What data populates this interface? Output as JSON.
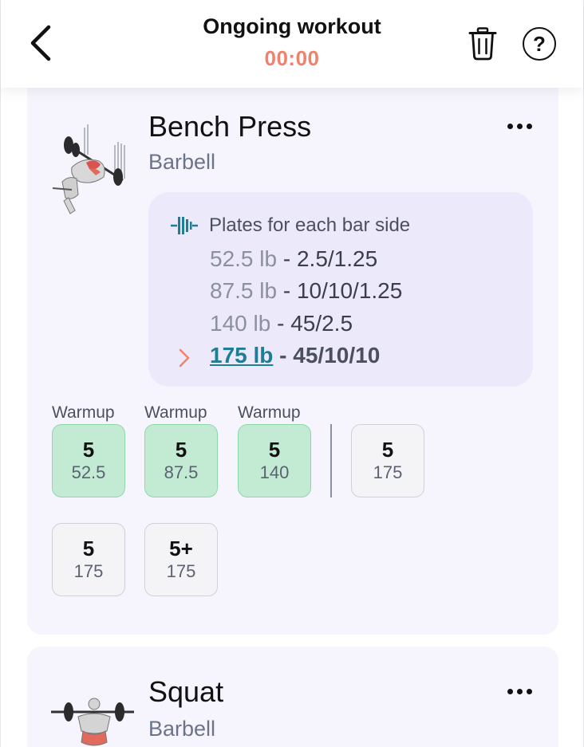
{
  "header": {
    "title": "Ongoing workout",
    "timer": "00:00",
    "icons": {
      "back": "chevron-left-icon",
      "trash": "trash-icon",
      "help": "help-icon"
    },
    "help_glyph": "?"
  },
  "exercises": [
    {
      "name": "Bench Press",
      "equipment": "Barbell",
      "plates": {
        "title": "Plates for each bar side",
        "rows": [
          {
            "weight": "52.5 lb",
            "separator": " - ",
            "plates": "2.5/1.25"
          },
          {
            "weight": "87.5 lb",
            "separator": " - ",
            "plates": "10/10/1.25"
          },
          {
            "weight": "140 lb",
            "separator": " - ",
            "plates": "45/2.5"
          },
          {
            "weight": "175 lb",
            "separator": " - ",
            "plates": "45/10/10"
          }
        ]
      },
      "warmup_label": "Warmup",
      "sets": [
        {
          "reps": "5",
          "weight": "52.5",
          "warmup": true,
          "completed": true
        },
        {
          "reps": "5",
          "weight": "87.5",
          "warmup": true,
          "completed": true
        },
        {
          "reps": "5",
          "weight": "140",
          "warmup": true,
          "completed": true
        },
        {
          "reps": "5",
          "weight": "175",
          "warmup": false,
          "completed": false
        },
        {
          "reps": "5",
          "weight": "175",
          "warmup": false,
          "completed": false
        },
        {
          "reps": "5+",
          "weight": "175",
          "warmup": false,
          "completed": false
        }
      ]
    },
    {
      "name": "Squat",
      "equipment": "Barbell"
    }
  ],
  "colors": {
    "accent_timer": "#f0826b",
    "card_bg": "#f6f5fd",
    "plates_bg": "#ece9fb",
    "done_set_bg": "#c3ebd3",
    "current_weight": "#1f7d94"
  }
}
